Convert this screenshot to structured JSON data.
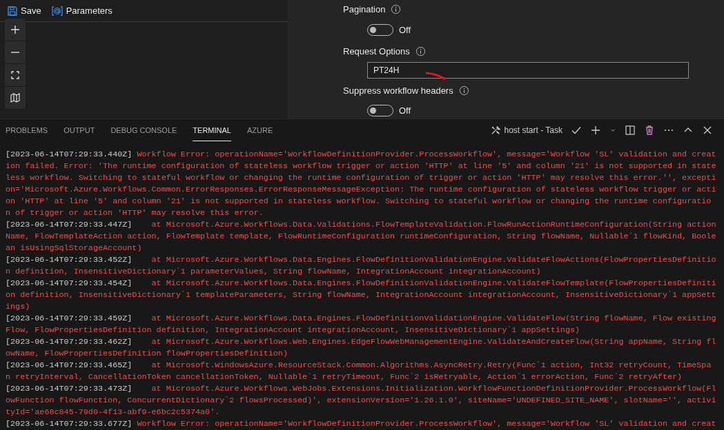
{
  "editor_toolbar": {
    "buttons": [
      {
        "label": "Save"
      },
      {
        "label": "Parameters"
      }
    ]
  },
  "settings": [
    {
      "kind": "toggle",
      "label": "Pagination",
      "on": false,
      "state_text": "Off"
    },
    {
      "kind": "text",
      "label": "Request Options",
      "value": "PT24H"
    },
    {
      "kind": "toggle",
      "label": "Suppress workflow headers",
      "on": false,
      "state_text": "Off"
    }
  ],
  "panel": {
    "tabs": [
      {
        "label": "PROBLEMS",
        "selected": false
      },
      {
        "label": "OUTPUT",
        "selected": false
      },
      {
        "label": "DEBUG CONSOLE",
        "selected": false
      },
      {
        "label": "TERMINAL",
        "selected": true
      },
      {
        "label": "AZURE",
        "selected": false
      }
    ],
    "task": "host start - Task"
  },
  "terminal": {
    "entries": [
      {
        "timestamp": "[2023-06-14T07:29:33.440Z]",
        "kind": "error",
        "message": "Workflow Error: operationName='WorkflowDefinitionProvider.ProcessWorkflow', message='Workflow 'SL' validation and creation failed. Error: 'The runtime configuration of stateless workflow trigger or action 'HTTP' at line '5' and column '21' is not supported in stateless workflow. Switching to stateful workflow or changing the runtime configuration of trigger or action 'HTTP' may resolve this error.'', exception='Microsoft.Azure.Workflows.Common.ErrorResponses.ErrorResponseMessageException: The runtime configuration of stateless workflow trigger or action 'HTTP' at line '5' and column '21' is not supported in stateless workflow. Switching to stateful workflow or changing the runtime configuration of trigger or action 'HTTP' may resolve this error."
      },
      {
        "timestamp": "[2023-06-14T07:29:33.447Z]",
        "kind": "stack",
        "message": "at Microsoft.Azure.Workflows.Data.Validations.FlowTemplateValidation.FlowRunActionRuntimeConfiguration(String actionName, FlowTemplateAction action, FlowTemplate template, FlowRuntimeConfiguration runtimeConfiguration, String flowName, Nullable`1 flowKind, Boolean isUsingSqlStorageAccount)"
      },
      {
        "timestamp": "[2023-06-14T07:29:33.452Z]",
        "kind": "stack",
        "message": "at Microsoft.Azure.Workflows.Data.Engines.FlowDefinitionValidationEngine.ValidateFlowActions(FlowPropertiesDefinition definition, InsensitiveDictionary`1 parameterValues, String flowName, IntegrationAccount integrationAccount)"
      },
      {
        "timestamp": "[2023-06-14T07:29:33.454Z]",
        "kind": "stack",
        "message": "at Microsoft.Azure.Workflows.Data.Engines.FlowDefinitionValidationEngine.ValidateFlowTemplate(FlowPropertiesDefinition definition, InsensitiveDictionary`1 templateParameters, String flowName, IntegrationAccount integrationAccount, InsensitiveDictionary`1 appSettings)"
      },
      {
        "timestamp": "[2023-06-14T07:29:33.459Z]",
        "kind": "stack",
        "message": "at Microsoft.Azure.Workflows.Data.Engines.FlowDefinitionValidationEngine.ValidateFlow(String flowName, Flow existingFlow, FlowPropertiesDefinition definition, IntegrationAccount integrationAccount, InsensitiveDictionary`1 appSettings)"
      },
      {
        "timestamp": "[2023-06-14T07:29:33.462Z]",
        "kind": "stack",
        "message": "at Microsoft.Azure.Workflows.Web.Engines.EdgeFlowWebManagementEngine.ValidateAndCreateFlow(String appName, String flowName, FlowPropertiesDefinition flowPropertiesDefinition)"
      },
      {
        "timestamp": "[2023-06-14T07:29:33.465Z]",
        "kind": "stack",
        "message": "at Microsoft.WindowsAzure.ResourceStack.Common.Algorithms.AsyncRetry.Retry(Func`1 action, Int32 retryCount, TimeSpan retryInterval, CancellationToken cancellationToken, Nullable`1 retryTimeout, Func`2 isRetryable, Action`1 errorAction, Func`2 retryAfter)"
      },
      {
        "timestamp": "[2023-06-14T07:29:33.473Z]",
        "kind": "stack",
        "message": "at Microsoft.Azure.Workflows.WebJobs.Extensions.Initialization.WorkflowFunctionDefinitionProvider.ProcessWorkflow(FlowFunction flowFunction, ConcurrentDictionary`2 flowsProcessed)', extensionVersion='1.26.1.0', siteName='UNDEFINED_SITE_NAME', slotName='', activityId='ae68c845-79d0-4f13-abf9-e6bc2c5374a0'."
      },
      {
        "timestamp": "[2023-06-14T07:29:33.677Z]",
        "kind": "error",
        "message": "Workflow Error: operationName='WorkflowDefinitionProvider.ProcessWorkflow', message='Workflow 'SL' validation and creat"
      }
    ]
  }
}
